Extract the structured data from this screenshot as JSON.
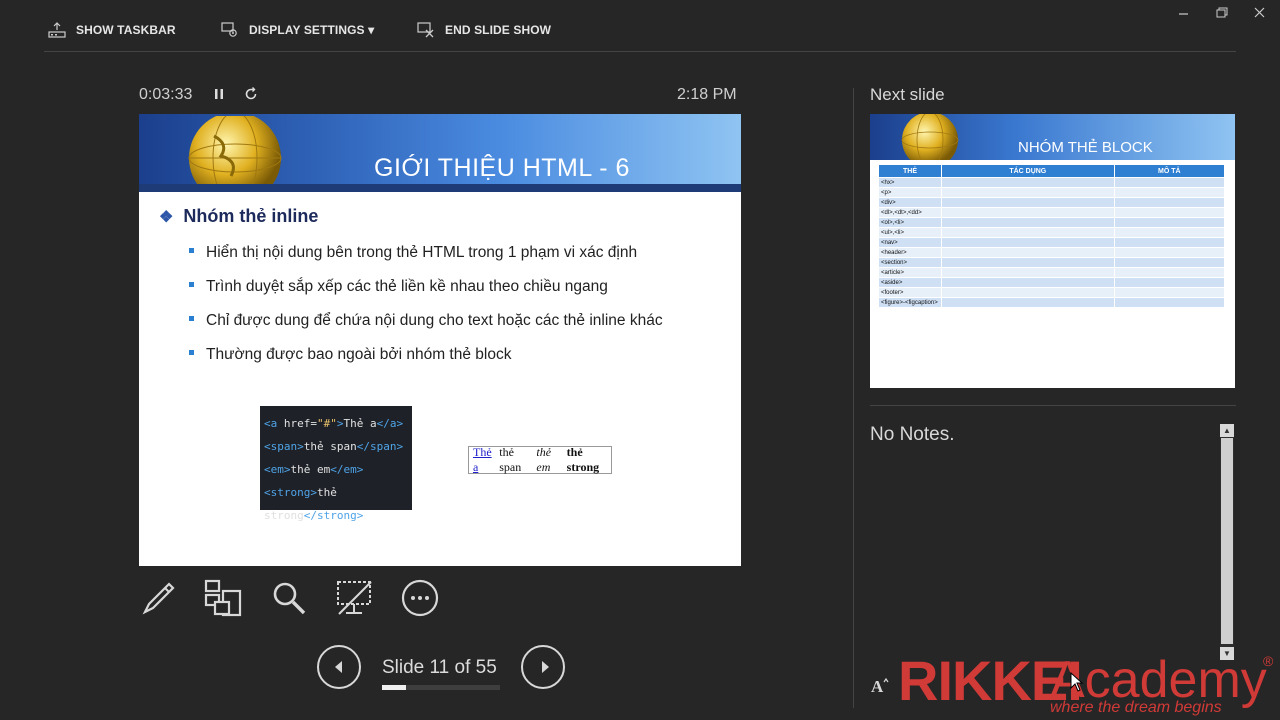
{
  "toolbar": {
    "show_taskbar": "SHOW TASKBAR",
    "display_settings": "DISPLAY SETTINGS ▾",
    "end_slide_show": "END SLIDE SHOW"
  },
  "presenter": {
    "elapsed": "0:03:33",
    "clock": "2:18 PM",
    "slide_counter": "Slide 11 of 55",
    "progress_fraction": 0.2
  },
  "slide": {
    "title": "GIỚI THIỆU HTML - 6",
    "heading": "Nhóm thẻ inline",
    "bullets": [
      "Hiển thị nội dung bên trong thẻ HTML trong 1 phạm vi xác định",
      "Trình duyệt sắp xếp các thẻ liền kề nhau theo chiều ngang",
      "Chỉ được dung để chứa nội dung cho text hoặc các thẻ inline khác",
      "Thường được bao ngoài bởi nhóm thẻ block"
    ],
    "code_lines": [
      {
        "open": "<a ",
        "attr": "href=",
        "str": "\"#\"",
        "close": ">",
        "text": "Thẻ a",
        "end": "</a>"
      },
      {
        "open": "<span>",
        "attr": "",
        "str": "",
        "close": "",
        "text": "thẻ span",
        "end": "</span>"
      },
      {
        "open": "<em>",
        "attr": "",
        "str": "",
        "close": "",
        "text": "thẻ em",
        "end": "</em>"
      },
      {
        "open": "<strong>",
        "attr": "",
        "str": "",
        "close": "",
        "text": "thẻ strong",
        "end": "</strong>"
      }
    ],
    "preview": {
      "link": "Thẻ a",
      "span": "thẻ span",
      "em": "thẻ em",
      "strong": "thẻ strong"
    }
  },
  "next_slide": {
    "label": "Next slide",
    "title": "NHÓM THẺ BLOCK",
    "columns": [
      "THẺ",
      "TÁC DỤNG",
      "MÔ TẢ"
    ],
    "rows": [
      "<hx>",
      "<p>",
      "<div>",
      "<dl>,<dt>,<dd>",
      "<ol>,<li>",
      "<ul>,<li>",
      "<nav>",
      "<header>",
      "<section>",
      "<article>",
      "<aside>",
      "<footer>",
      "<figure>-<figcaption>"
    ]
  },
  "notes": {
    "text": "No Notes."
  },
  "logo": {
    "brand": "RIKKEI",
    "name": "Academy",
    "tagline": "where the dream begins",
    "reg": "®"
  },
  "colors": {
    "background": "#262626",
    "logo_red": "#d03a37",
    "slide_blue": "#1d2a5c"
  }
}
